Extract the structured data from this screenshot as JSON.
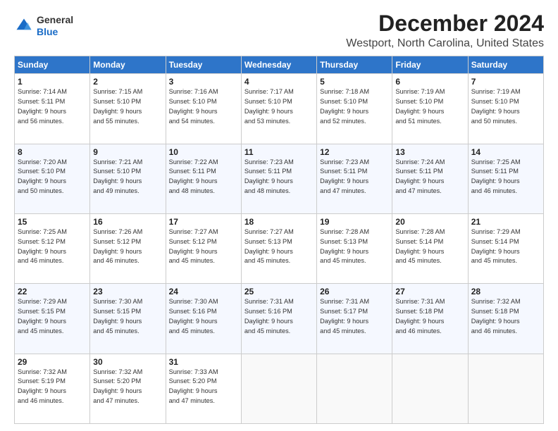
{
  "header": {
    "logo_general": "General",
    "logo_blue": "Blue",
    "title": "December 2024",
    "subtitle": "Westport, North Carolina, United States"
  },
  "calendar": {
    "days_of_week": [
      "Sunday",
      "Monday",
      "Tuesday",
      "Wednesday",
      "Thursday",
      "Friday",
      "Saturday"
    ],
    "weeks": [
      [
        {
          "day": "1",
          "sunrise": "Sunrise: 7:14 AM",
          "sunset": "Sunset: 5:11 PM",
          "daylight": "Daylight: 9 hours and 56 minutes."
        },
        {
          "day": "2",
          "sunrise": "Sunrise: 7:15 AM",
          "sunset": "Sunset: 5:10 PM",
          "daylight": "Daylight: 9 hours and 55 minutes."
        },
        {
          "day": "3",
          "sunrise": "Sunrise: 7:16 AM",
          "sunset": "Sunset: 5:10 PM",
          "daylight": "Daylight: 9 hours and 54 minutes."
        },
        {
          "day": "4",
          "sunrise": "Sunrise: 7:17 AM",
          "sunset": "Sunset: 5:10 PM",
          "daylight": "Daylight: 9 hours and 53 minutes."
        },
        {
          "day": "5",
          "sunrise": "Sunrise: 7:18 AM",
          "sunset": "Sunset: 5:10 PM",
          "daylight": "Daylight: 9 hours and 52 minutes."
        },
        {
          "day": "6",
          "sunrise": "Sunrise: 7:19 AM",
          "sunset": "Sunset: 5:10 PM",
          "daylight": "Daylight: 9 hours and 51 minutes."
        },
        {
          "day": "7",
          "sunrise": "Sunrise: 7:19 AM",
          "sunset": "Sunset: 5:10 PM",
          "daylight": "Daylight: 9 hours and 50 minutes."
        }
      ],
      [
        {
          "day": "8",
          "sunrise": "Sunrise: 7:20 AM",
          "sunset": "Sunset: 5:10 PM",
          "daylight": "Daylight: 9 hours and 50 minutes."
        },
        {
          "day": "9",
          "sunrise": "Sunrise: 7:21 AM",
          "sunset": "Sunset: 5:10 PM",
          "daylight": "Daylight: 9 hours and 49 minutes."
        },
        {
          "day": "10",
          "sunrise": "Sunrise: 7:22 AM",
          "sunset": "Sunset: 5:11 PM",
          "daylight": "Daylight: 9 hours and 48 minutes."
        },
        {
          "day": "11",
          "sunrise": "Sunrise: 7:23 AM",
          "sunset": "Sunset: 5:11 PM",
          "daylight": "Daylight: 9 hours and 48 minutes."
        },
        {
          "day": "12",
          "sunrise": "Sunrise: 7:23 AM",
          "sunset": "Sunset: 5:11 PM",
          "daylight": "Daylight: 9 hours and 47 minutes."
        },
        {
          "day": "13",
          "sunrise": "Sunrise: 7:24 AM",
          "sunset": "Sunset: 5:11 PM",
          "daylight": "Daylight: 9 hours and 47 minutes."
        },
        {
          "day": "14",
          "sunrise": "Sunrise: 7:25 AM",
          "sunset": "Sunset: 5:11 PM",
          "daylight": "Daylight: 9 hours and 46 minutes."
        }
      ],
      [
        {
          "day": "15",
          "sunrise": "Sunrise: 7:25 AM",
          "sunset": "Sunset: 5:12 PM",
          "daylight": "Daylight: 9 hours and 46 minutes."
        },
        {
          "day": "16",
          "sunrise": "Sunrise: 7:26 AM",
          "sunset": "Sunset: 5:12 PM",
          "daylight": "Daylight: 9 hours and 46 minutes."
        },
        {
          "day": "17",
          "sunrise": "Sunrise: 7:27 AM",
          "sunset": "Sunset: 5:12 PM",
          "daylight": "Daylight: 9 hours and 45 minutes."
        },
        {
          "day": "18",
          "sunrise": "Sunrise: 7:27 AM",
          "sunset": "Sunset: 5:13 PM",
          "daylight": "Daylight: 9 hours and 45 minutes."
        },
        {
          "day": "19",
          "sunrise": "Sunrise: 7:28 AM",
          "sunset": "Sunset: 5:13 PM",
          "daylight": "Daylight: 9 hours and 45 minutes."
        },
        {
          "day": "20",
          "sunrise": "Sunrise: 7:28 AM",
          "sunset": "Sunset: 5:14 PM",
          "daylight": "Daylight: 9 hours and 45 minutes."
        },
        {
          "day": "21",
          "sunrise": "Sunrise: 7:29 AM",
          "sunset": "Sunset: 5:14 PM",
          "daylight": "Daylight: 9 hours and 45 minutes."
        }
      ],
      [
        {
          "day": "22",
          "sunrise": "Sunrise: 7:29 AM",
          "sunset": "Sunset: 5:15 PM",
          "daylight": "Daylight: 9 hours and 45 minutes."
        },
        {
          "day": "23",
          "sunrise": "Sunrise: 7:30 AM",
          "sunset": "Sunset: 5:15 PM",
          "daylight": "Daylight: 9 hours and 45 minutes."
        },
        {
          "day": "24",
          "sunrise": "Sunrise: 7:30 AM",
          "sunset": "Sunset: 5:16 PM",
          "daylight": "Daylight: 9 hours and 45 minutes."
        },
        {
          "day": "25",
          "sunrise": "Sunrise: 7:31 AM",
          "sunset": "Sunset: 5:16 PM",
          "daylight": "Daylight: 9 hours and 45 minutes."
        },
        {
          "day": "26",
          "sunrise": "Sunrise: 7:31 AM",
          "sunset": "Sunset: 5:17 PM",
          "daylight": "Daylight: 9 hours and 45 minutes."
        },
        {
          "day": "27",
          "sunrise": "Sunrise: 7:31 AM",
          "sunset": "Sunset: 5:18 PM",
          "daylight": "Daylight: 9 hours and 46 minutes."
        },
        {
          "day": "28",
          "sunrise": "Sunrise: 7:32 AM",
          "sunset": "Sunset: 5:18 PM",
          "daylight": "Daylight: 9 hours and 46 minutes."
        }
      ],
      [
        {
          "day": "29",
          "sunrise": "Sunrise: 7:32 AM",
          "sunset": "Sunset: 5:19 PM",
          "daylight": "Daylight: 9 hours and 46 minutes."
        },
        {
          "day": "30",
          "sunrise": "Sunrise: 7:32 AM",
          "sunset": "Sunset: 5:20 PM",
          "daylight": "Daylight: 9 hours and 47 minutes."
        },
        {
          "day": "31",
          "sunrise": "Sunrise: 7:33 AM",
          "sunset": "Sunset: 5:20 PM",
          "daylight": "Daylight: 9 hours and 47 minutes."
        },
        null,
        null,
        null,
        null
      ]
    ]
  }
}
